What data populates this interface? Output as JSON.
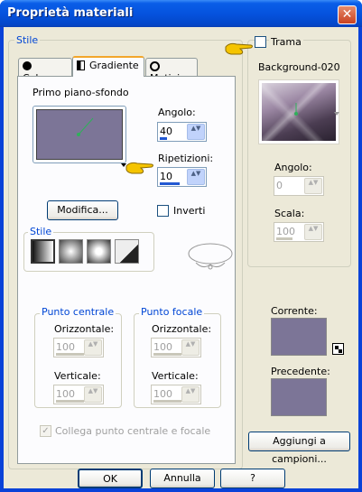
{
  "window": {
    "title": "Proprietà materiali",
    "close_glyph": "✕"
  },
  "stile_group": {
    "label": "Stile"
  },
  "tabs": [
    {
      "label": "Colore"
    },
    {
      "label": "Gradiente"
    },
    {
      "label": "Motivi"
    }
  ],
  "gradient": {
    "section_label": "Primo piano-sfondo",
    "angle_label": "Angolo:",
    "angle_value": "40",
    "repeat_label": "Ripetizioni:",
    "repeat_value": "10",
    "modify_button": "Modifica...",
    "invert_label": "Inverti",
    "style_label": "Stile"
  },
  "center_point": {
    "label": "Punto centrale",
    "horizontal_label": "Orizzontale:",
    "horizontal_value": "100",
    "vertical_label": "Verticale:",
    "vertical_value": "100"
  },
  "focal_point": {
    "label": "Punto focale",
    "horizontal_label": "Orizzontale:",
    "horizontal_value": "100",
    "vertical_label": "Verticale:",
    "vertical_value": "100"
  },
  "link_checkbox_label": "Collega punto centrale e focale",
  "texture": {
    "label": "Trama",
    "name": "Background-020",
    "angle_label": "Angolo:",
    "angle_value": "0",
    "scale_label": "Scala:",
    "scale_value": "100"
  },
  "current_label": "Corrente:",
  "previous_label": "Precedente:",
  "add_swatch_button": "Aggiungi a campioni...",
  "footer": {
    "ok": "OK",
    "cancel": "Annulla",
    "help": "?"
  },
  "colors": {
    "swatch": "#7c7597",
    "titlebar": "#0553de",
    "client": "#ece9d8",
    "accent": "#0046d5"
  }
}
